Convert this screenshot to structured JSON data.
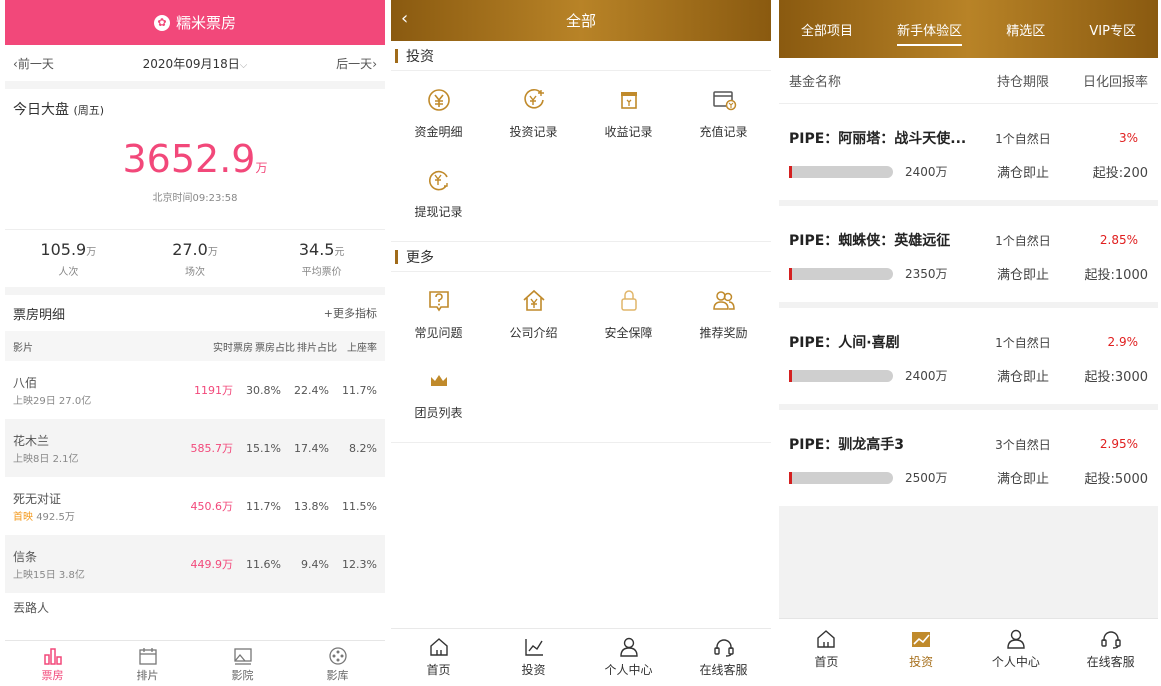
{
  "panel1": {
    "app_title": "糯米票房",
    "prev_day": "前一天",
    "date": "2020年09月18日",
    "next_day": "后一天",
    "today_label": "今日大盘",
    "weekday": "(周五)",
    "total_value": "3652.9",
    "total_unit": "万",
    "beijing_time": "北京时间09:23:58",
    "stats": [
      {
        "value": "105.9",
        "unit": "万",
        "label": "人次"
      },
      {
        "value": "27.0",
        "unit": "万",
        "label": "场次"
      },
      {
        "value": "34.5",
        "unit": "元",
        "label": "平均票价"
      }
    ],
    "detail_title": "票房明细",
    "more_metrics": "+更多指标",
    "columns": {
      "film": "影片",
      "realtime": "实时票房",
      "share": "票房占比",
      "schedule": "排片占比",
      "occupancy": "上座率"
    },
    "rows": [
      {
        "name": "八佰",
        "sub_prefix": "上映29日",
        "sub_value": "27.0亿",
        "realtime": "1191万",
        "share": "30.8%",
        "schedule": "22.4%",
        "occupancy": "11.7%"
      },
      {
        "name": "花木兰",
        "sub_prefix": "上映8日",
        "sub_value": "2.1亿",
        "realtime": "585.7万",
        "share": "15.1%",
        "schedule": "17.4%",
        "occupancy": "8.2%"
      },
      {
        "name": "死无对证",
        "sub_prefix": "首映",
        "sub_value": "492.5万",
        "realtime": "450.6万",
        "share": "11.7%",
        "schedule": "13.8%",
        "occupancy": "11.5%"
      },
      {
        "name": "信条",
        "sub_prefix": "上映15日",
        "sub_value": "3.8亿",
        "realtime": "449.9万",
        "share": "11.6%",
        "schedule": "9.4%",
        "occupancy": "12.3%"
      }
    ],
    "partial_row_name": "丟路人",
    "tabs": [
      "票房",
      "排片",
      "影院",
      "影库"
    ],
    "accent_color": "#f2487a"
  },
  "panel2": {
    "title": "全部",
    "back_icon": "chevron-left-icon",
    "sections": [
      {
        "title": "投资",
        "items": [
          "资金明细",
          "投资记录",
          "收益记录",
          "充值记录",
          "提现记录"
        ]
      },
      {
        "title": "更多",
        "items": [
          "常见问题",
          "公司介绍",
          "安全保障",
          "推荐奖励",
          "团员列表"
        ]
      }
    ],
    "tabs": [
      "首页",
      "投资",
      "个人中心",
      "在线客服"
    ],
    "accent_color": "#a06b1a"
  },
  "panel3": {
    "top_tabs": [
      "全部项目",
      "新手体验区",
      "精选区",
      "VIP专区"
    ],
    "active_top_tab": "新手体验区",
    "columns": {
      "name": "基金名称",
      "period": "持仓期限",
      "rate": "日化回报率"
    },
    "funds": [
      {
        "title": "PIPE：阿丽塔：战斗天使...",
        "period": "1个自然日",
        "rate": "3%",
        "amount": "2400万",
        "stop": "满仓即止",
        "min": "起投:200",
        "progress": 0.03
      },
      {
        "title": "PIPE：蜘蛛侠：英雄远征",
        "period": "1个自然日",
        "rate": "2.85%",
        "amount": "2350万",
        "stop": "满仓即止",
        "min": "起投:1000",
        "progress": 0.03
      },
      {
        "title": "PIPE：人间·喜剧",
        "period": "1个自然日",
        "rate": "2.9%",
        "amount": "2400万",
        "stop": "满仓即止",
        "min": "起投:3000",
        "progress": 0.03
      },
      {
        "title": "PIPE：驯龙高手3",
        "period": "3个自然日",
        "rate": "2.95%",
        "amount": "2500万",
        "stop": "满仓即止",
        "min": "起投:5000",
        "progress": 0.03
      }
    ],
    "tabs": [
      "首页",
      "投资",
      "个人中心",
      "在线客服"
    ],
    "active_tab": "投资",
    "rate_color": "#e02020"
  }
}
